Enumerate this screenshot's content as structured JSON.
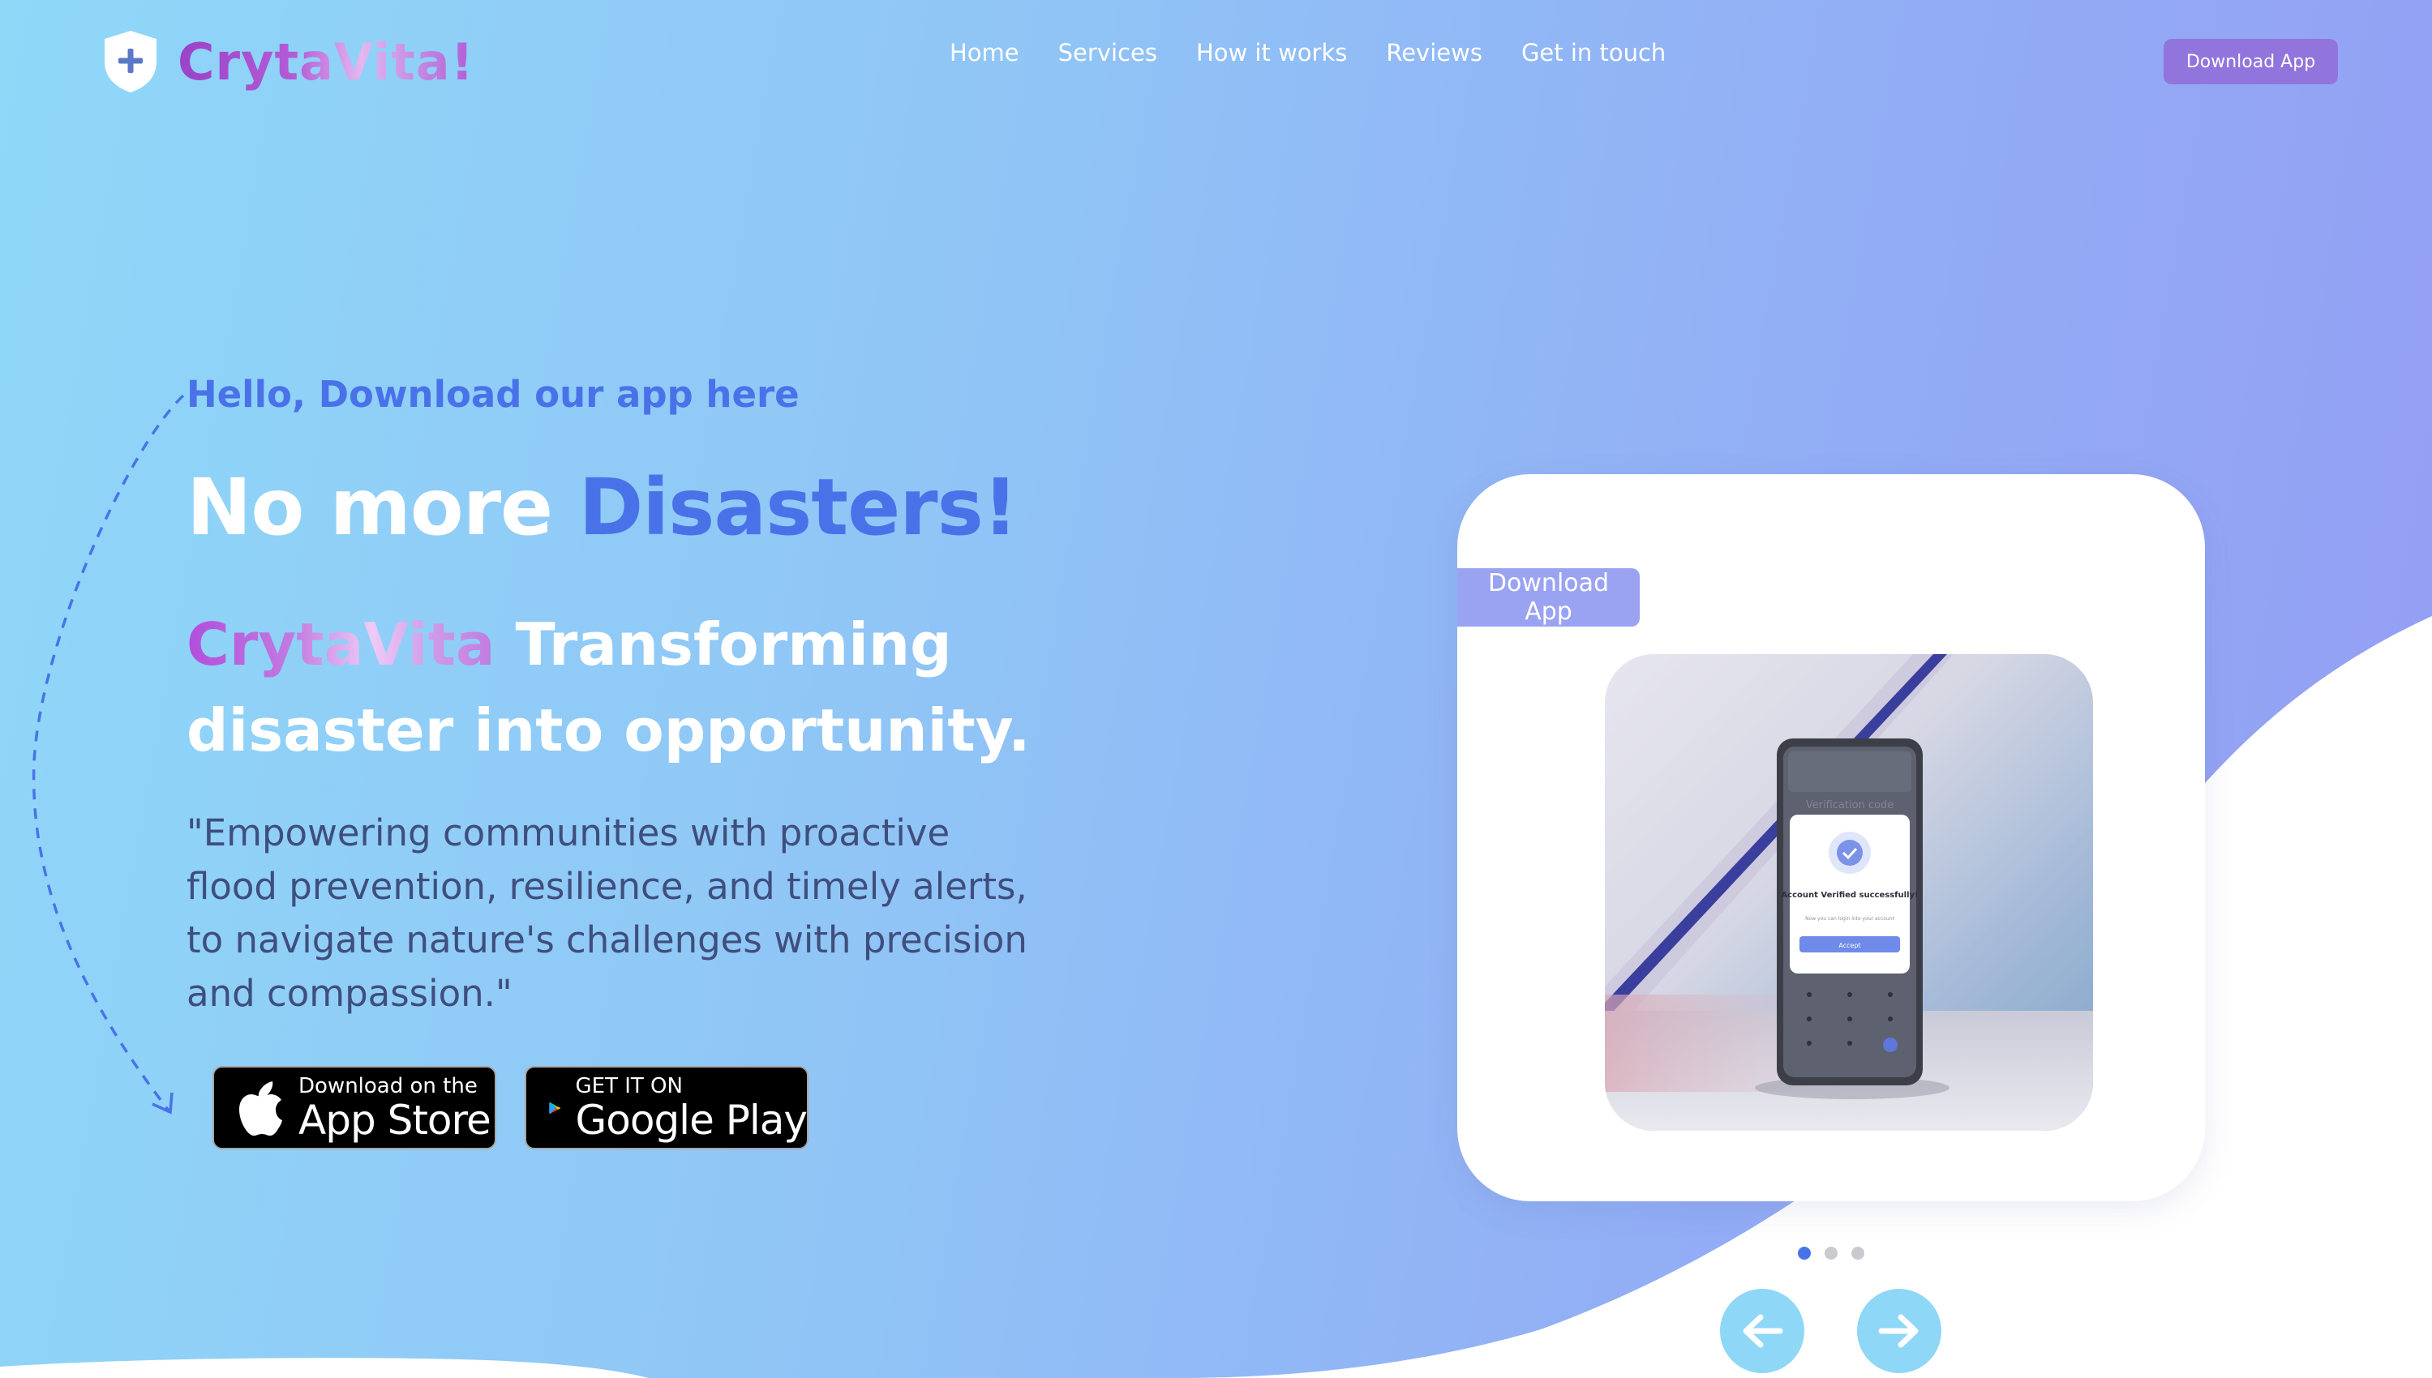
{
  "brand": {
    "name": "CrytaVita!"
  },
  "nav": {
    "items": [
      {
        "label": "Home"
      },
      {
        "label": "Services"
      },
      {
        "label": "How it works"
      },
      {
        "label": "Reviews"
      },
      {
        "label": "Get in touch"
      }
    ],
    "cta_label": "Download App"
  },
  "hero": {
    "greeting": "Hello, Download our app here",
    "headline_prefix": "No more ",
    "headline_accent": "Disasters!",
    "subhead_brand": "CrytaVita",
    "subhead_rest": " Transforming disaster into opportunity.",
    "quote": "\"Empowering communities with proactive flood prevention, resilience, and timely alerts, to navigate nature's challenges with precision and compassion.\""
  },
  "stores": {
    "apple": {
      "small": "Download on the",
      "big": "App Store"
    },
    "google": {
      "small": "GET IT ON",
      "big": "Google Play"
    }
  },
  "card": {
    "tag_label": "Download App",
    "phone_title": "Verification code",
    "phone_message": "Account Verified successfully!",
    "phone_note": "Now you can login into your account",
    "phone_button": "Accept"
  },
  "carousel": {
    "slide_count": 3,
    "active_index": 0
  },
  "colors": {
    "accent": "#4a72e8",
    "brand_purple": "#9a42c9",
    "button_purple": "#9274dd",
    "tag_lavender": "#9aa3f2",
    "arrow_cyan": "#8ed7f6",
    "quote_text": "#3f4e7c"
  },
  "icons": {
    "logo": "shield-plus-icon",
    "apple": "apple-icon",
    "google": "google-play-icon",
    "prev": "arrow-left-icon",
    "next": "arrow-right-icon"
  }
}
